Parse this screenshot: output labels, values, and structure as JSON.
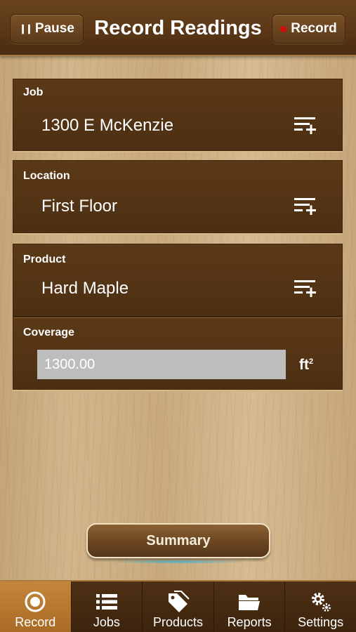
{
  "navbar": {
    "title": "Record Readings",
    "pause_label": "Pause",
    "record_label": "Record"
  },
  "panels": {
    "job": {
      "label": "Job",
      "value": "1300 E McKenzie",
      "action_icon": "list-add-icon"
    },
    "location": {
      "label": "Location",
      "value": "First Floor",
      "action_icon": "list-add-icon"
    },
    "product": {
      "label": "Product",
      "value": "Hard Maple",
      "action_icon": "list-add-icon"
    },
    "coverage": {
      "label": "Coverage",
      "value": "1300.00",
      "unit": "ft",
      "unit_exp": "2"
    }
  },
  "summary_label": "Summary",
  "tabs": [
    {
      "label": "Record",
      "icon": "record-icon",
      "active": true
    },
    {
      "label": "Jobs",
      "icon": "list-icon",
      "active": false
    },
    {
      "label": "Products",
      "icon": "tag-icon",
      "active": false
    },
    {
      "label": "Reports",
      "icon": "folder-icon",
      "active": false
    },
    {
      "label": "Settings",
      "icon": "gears-icon",
      "active": false
    }
  ],
  "colors": {
    "wood_dark": "#4c2f12",
    "tab_active": "#c4873a",
    "record_dot": "#d40c0c"
  }
}
